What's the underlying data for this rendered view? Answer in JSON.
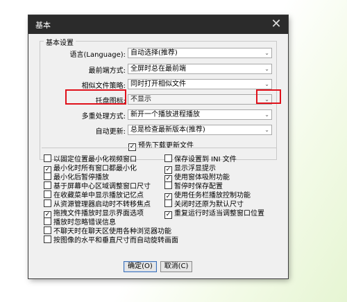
{
  "window": {
    "title": "基本",
    "close_glyph": "✕"
  },
  "group": {
    "title": "基本设置"
  },
  "settings": [
    {
      "label": "语言(Language):",
      "value": "自动选择(推荐)"
    },
    {
      "label": "最前端方式:",
      "value": "全屏时总在最前端"
    },
    {
      "label": "相似文件策略:",
      "value": "同时打开相似文件"
    },
    {
      "label": "托盘图标:",
      "value": "不显示"
    },
    {
      "label": "多重处理方式:",
      "value": "新开一个播放进程播放"
    },
    {
      "label": "自动更新:",
      "value": "总是检查最新版本(推荐)"
    }
  ],
  "predownload": {
    "label": "预先下载更新文件",
    "checked": true
  },
  "left_options": [
    {
      "label": "以固定位置最小化视频窗口",
      "checked": false
    },
    {
      "label": "最小化时所有窗口都最小化",
      "checked": true
    },
    {
      "label": "最小化后暂停播放",
      "checked": false
    },
    {
      "label": "基于屏幕中心区域调整窗口尺寸",
      "checked": false
    },
    {
      "label": "在收藏菜单中显示播放记忆点",
      "checked": false
    },
    {
      "label": "从资源管理器启动时不转移焦点",
      "checked": false
    },
    {
      "label": "拖拽文件播放时显示界面选项",
      "checked": true
    },
    {
      "label": "播放时忽略错误信息",
      "checked": false
    },
    {
      "label": "不聊天时在聊天区使用各种浏览器功能",
      "checked": false
    },
    {
      "label": "按图像的水平和垂直尺寸而自动旋转画面",
      "checked": false
    }
  ],
  "right_options": [
    {
      "label": "保存设置到 INI 文件",
      "checked": false
    },
    {
      "label": "显示浮显提示",
      "checked": true
    },
    {
      "label": "使用窗体吸附功能",
      "checked": true
    },
    {
      "label": "暂停时保存配置",
      "checked": false
    },
    {
      "label": "使用任务栏播放控制功能",
      "checked": true
    },
    {
      "label": "关闭时还原为默认尺寸",
      "checked": false
    },
    {
      "label": "重复运行时适当调整窗口位置",
      "checked": true
    }
  ],
  "buttons": {
    "ok": "确定(O)",
    "cancel": "取消(C)"
  },
  "colors": {
    "titlebar": "#2b2b2b",
    "highlight": "#e0101a",
    "dialog": "#f0f0f0"
  },
  "icons": {
    "combo_arrow": "chevron-down-icon",
    "close": "close-icon",
    "check": "checkmark-icon"
  }
}
